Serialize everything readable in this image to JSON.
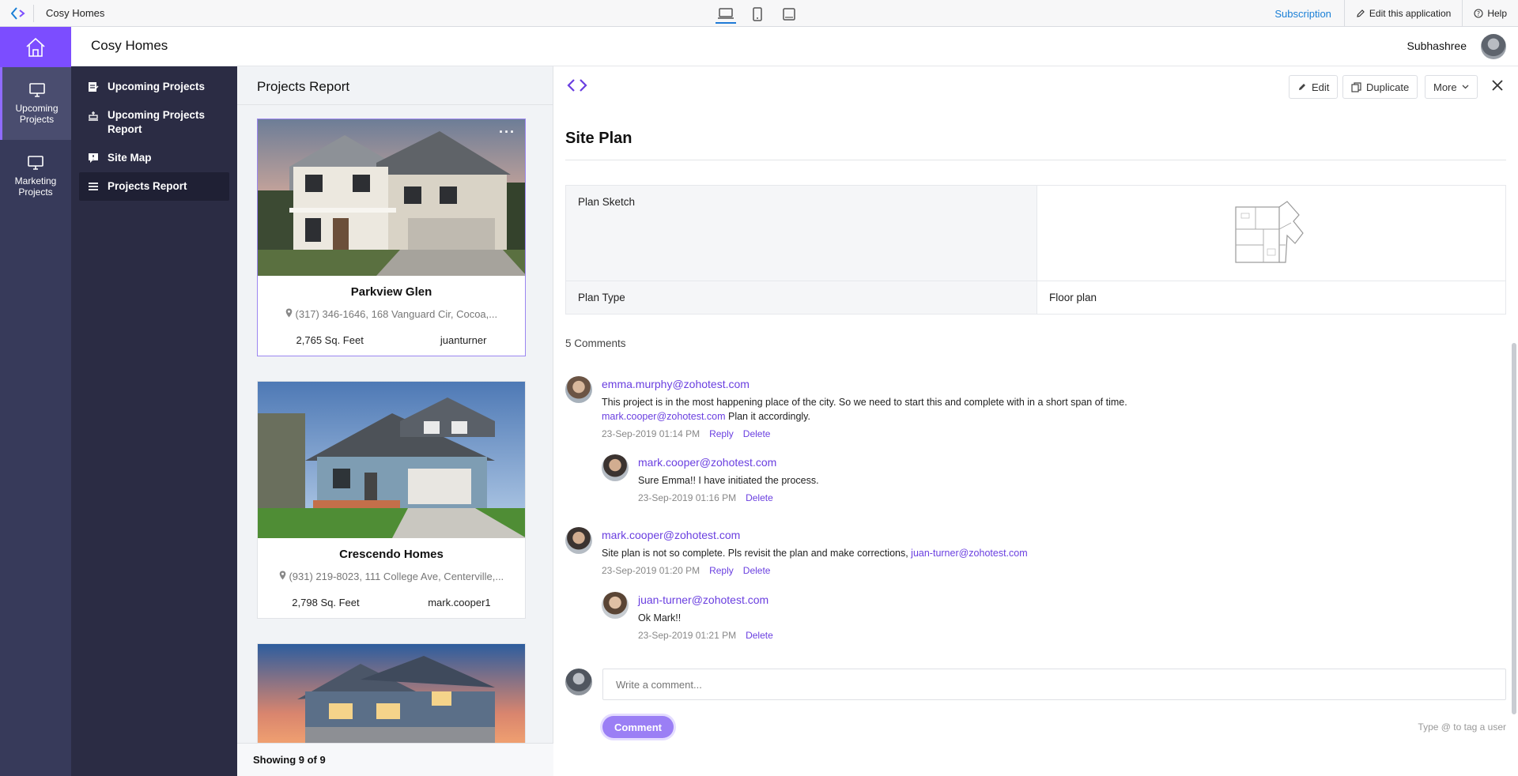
{
  "topbar": {
    "app_name": "Cosy Homes",
    "subscription": "Subscription",
    "edit_app": "Edit this application",
    "help": "Help"
  },
  "header": {
    "title": "Cosy Homes",
    "user": "Subhashree"
  },
  "rail": {
    "items": [
      {
        "label": "Upcoming Projects"
      },
      {
        "label": "Marketing Projects"
      }
    ]
  },
  "subnav": {
    "items": [
      {
        "label": "Upcoming Projects"
      },
      {
        "label": "Upcoming Projects Report"
      },
      {
        "label": "Site Map"
      },
      {
        "label": "Projects Report"
      }
    ]
  },
  "report": {
    "title": "Projects Report",
    "footer": "Showing 9 of 9",
    "cards": [
      {
        "name": "Parkview Glen",
        "address": "(317) 346-1646, 168 Vanguard Cir, Cocoa,...",
        "area": "2,765 Sq. Feet",
        "owner": "juanturner"
      },
      {
        "name": "Crescendo Homes",
        "address": "(931) 219-8023, 111 College Ave, Centerville,...",
        "area": "2,798 Sq. Feet",
        "owner": "mark.cooper1"
      }
    ]
  },
  "detail": {
    "edit": "Edit",
    "duplicate": "Duplicate",
    "more": "More",
    "section_title": "Site Plan",
    "rows": [
      {
        "label": "Plan Sketch",
        "value": ""
      },
      {
        "label": "Plan Type",
        "value": "Floor plan"
      }
    ],
    "comments_count": "5 Comments",
    "comments": [
      {
        "user": "emma.murphy@zohotest.com",
        "text1": "This project is in the most happening place of the city. So we need to start this and complete with in a short span of time.",
        "mention": "mark.cooper@zohotest.com",
        "text2": " Plan it accordingly.",
        "time": "23-Sep-2019 01:14 PM",
        "reply": "Reply",
        "delete": "Delete"
      },
      {
        "user": "mark.cooper@zohotest.com",
        "text1": "Sure Emma!! I have initiated the process.",
        "time": "23-Sep-2019 01:16 PM",
        "delete": "Delete"
      },
      {
        "user": "mark.cooper@zohotest.com",
        "text1": "Site plan is not so complete. Pls revisit the plan and make corrections, ",
        "mention": "juan-turner@zohotest.com",
        "time": "23-Sep-2019 01:20 PM",
        "reply": "Reply",
        "delete": "Delete"
      },
      {
        "user": "juan-turner@zohotest.com",
        "text1": "Ok Mark!!",
        "time": "23-Sep-2019 01:21 PM",
        "delete": "Delete"
      }
    ],
    "comment_placeholder": "Write a comment...",
    "comment_button": "Comment",
    "hint": "Type @ to tag a user"
  },
  "colors": {
    "rail_bg": "#373a5a",
    "subnav_bg": "#2b2c44",
    "accent": "#7c4dff",
    "link": "#6a3fe0",
    "subscription_link": "#1a7fd6"
  }
}
